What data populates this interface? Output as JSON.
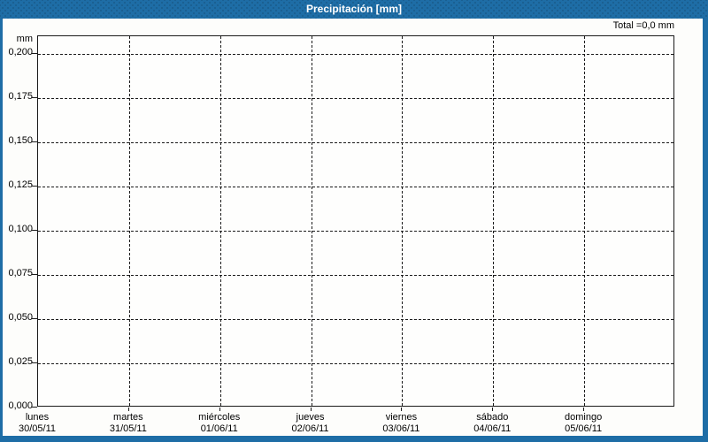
{
  "window": {
    "title": "Precipitación [mm]",
    "accent_color": "#1e6da6",
    "plot_border_color": "#1a1a1a",
    "grid_color": "#1a1a1a",
    "background_color": "#fdfdfb"
  },
  "chart": {
    "total_label": "Total =0,0 mm",
    "unit_label": "mm"
  },
  "chart_data": {
    "type": "bar",
    "title": "Precipitación [mm]",
    "ylabel": "mm",
    "xlabel": "",
    "ylim": [
      0,
      0.21
    ],
    "ytick_step": 0.025,
    "ytick_labels": [
      "0,000",
      "0,025",
      "0,050",
      "0,075",
      "0,100",
      "0,125",
      "0,150",
      "0,175",
      "0,200"
    ],
    "grid": "dashed",
    "legend": "none",
    "categories": [
      {
        "day": "lunes",
        "date": "30/05/11"
      },
      {
        "day": "martes",
        "date": "31/05/11"
      },
      {
        "day": "miércoles",
        "date": "01/06/11"
      },
      {
        "day": "jueves",
        "date": "02/06/11"
      },
      {
        "day": "viernes",
        "date": "03/06/11"
      },
      {
        "day": "sábado",
        "date": "04/06/11"
      },
      {
        "day": "domingo",
        "date": "05/06/11"
      }
    ],
    "values": [
      0,
      0,
      0,
      0,
      0,
      0,
      0
    ],
    "total_mm": "0,0"
  }
}
